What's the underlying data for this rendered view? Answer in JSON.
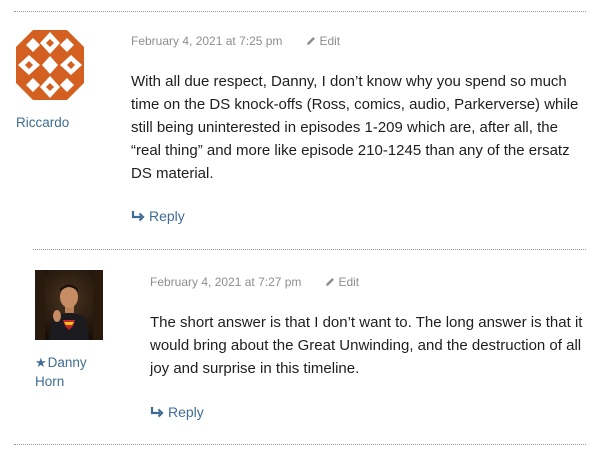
{
  "comments": [
    {
      "author": "Riccardo",
      "date": "February 4, 2021 at 7:25 pm",
      "edit_label": "Edit",
      "text": "With all due respect, Danny, I don’t know why you spend so much time on the DS knock-offs (Ross, comics, audio, Parkerverse) while still being uninterested in episodes 1-209 which are, after all, the “real thing” and more like episode 210-1245 than any of the ersatz DS material.",
      "reply_label": "Reply",
      "avatar_color": "#d35f20"
    },
    {
      "author_star": "★",
      "author": "Danny Horn",
      "date": "February 4, 2021 at 7:27 pm",
      "edit_label": "Edit",
      "text": "The short answer is that I don’t want to. The long answer is that it would bring about the Great Unwinding, and the destruction of all joy and surprise in this timeline.",
      "reply_label": "Reply"
    }
  ],
  "colors": {
    "link": "#3f6c93",
    "meta": "#8e8e8e",
    "text": "#1e1e1e",
    "separator": "#9a9a9a"
  }
}
